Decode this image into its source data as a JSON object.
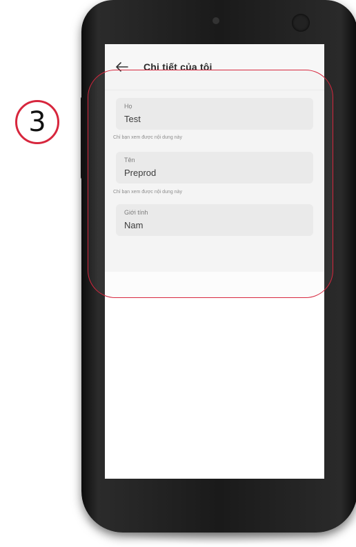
{
  "step": {
    "number": "3"
  },
  "header": {
    "title": "Chi tiết của tôi",
    "back_icon": "arrow-left-icon"
  },
  "fields": [
    {
      "label": "Họ",
      "value": "Test",
      "helper": "Chỉ bạn xem được nội dung này"
    },
    {
      "label": "Tên",
      "value": "Preprod",
      "helper": "Chỉ bạn xem được nội dung này"
    },
    {
      "label": "Giới tính",
      "value": "Nam"
    }
  ],
  "colors": {
    "highlight": "#d7263d",
    "field_bg": "#ececec",
    "screen_bg": "#f7f7f7"
  }
}
